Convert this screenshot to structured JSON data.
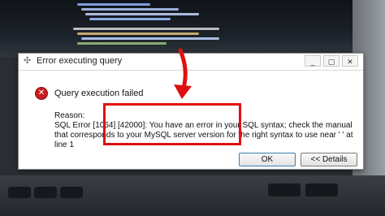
{
  "dialog": {
    "title": "Error executing query",
    "heading": "Query execution failed",
    "reason_label": "Reason:",
    "message": "SQL Error [1064] [42000]: You have an error in your SQL syntax; check the manual that corresponds to your MySQL server version for the right syntax to use near ' ' at line 1",
    "buttons": {
      "ok": "OK",
      "details": "<< Details"
    },
    "window_controls": {
      "minimize": "_",
      "restore": "▢",
      "close": "✕"
    }
  },
  "icons": {
    "title_icon": "sparkle-icon",
    "error_icon": "error-circle-icon",
    "error_glyph": "✕"
  },
  "colors": {
    "highlight": "#e11010",
    "arrow": "#e11010",
    "error_icon": "#c81e1e"
  }
}
